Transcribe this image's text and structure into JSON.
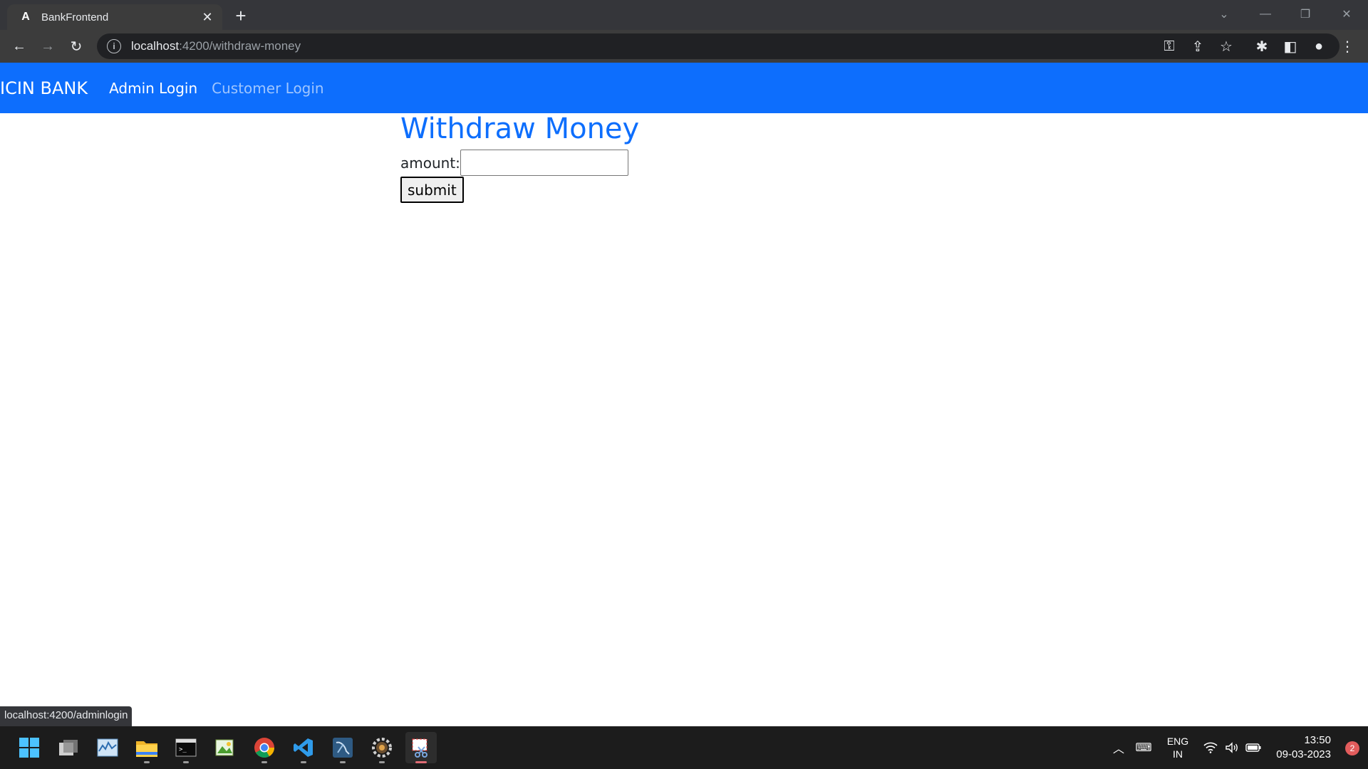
{
  "browser": {
    "tab": {
      "title": "BankFrontend",
      "favicon": "angular-icon"
    },
    "address": {
      "host": "localhost",
      "path": ":4200/withdraw-money"
    },
    "status_url": "localhost:4200/adminlogin"
  },
  "navbar": {
    "brand": "ICIN BANK",
    "links": [
      "Admin Login",
      "Customer Login"
    ],
    "color": "#0d6efd"
  },
  "page": {
    "heading": "Withdraw Money",
    "amount_label": "amount:",
    "amount_value": "",
    "submit_label": "submit"
  },
  "taskbar": {
    "apps": [
      "windows-start-icon",
      "task-view-icon",
      "resource-monitor-icon",
      "file-explorer-icon",
      "terminal-icon",
      "image-viewer-icon",
      "chrome-icon",
      "vscode-icon",
      "mysql-workbench-icon",
      "settings-icon",
      "snipping-tool-icon"
    ],
    "language": {
      "line1": "ENG",
      "line2": "IN"
    },
    "time": "13:50",
    "date": "09-03-2023",
    "notifications": "2"
  }
}
